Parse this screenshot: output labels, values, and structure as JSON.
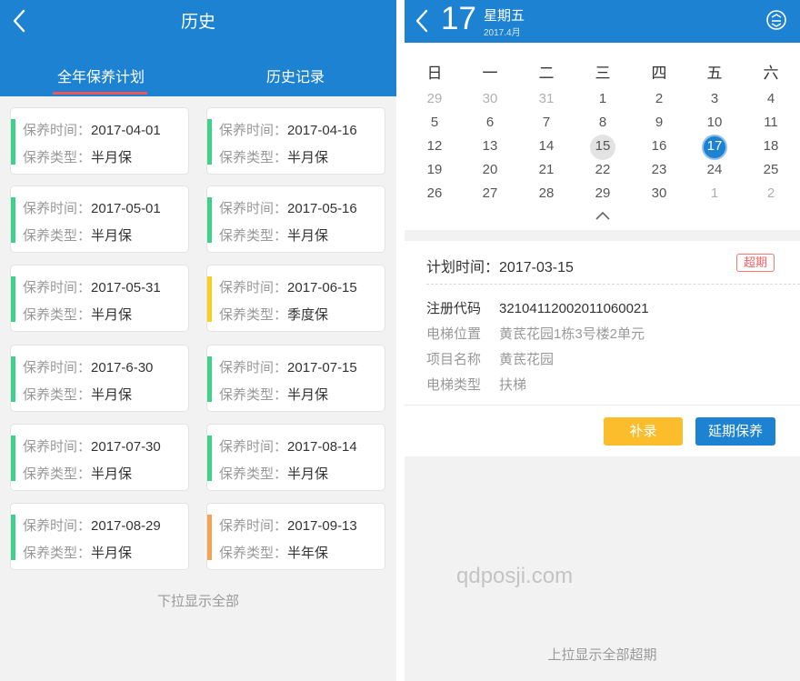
{
  "left": {
    "header": {
      "title": "历史"
    },
    "tabs": [
      {
        "label": "全年保养计划",
        "active": true
      },
      {
        "label": "历史记录",
        "active": false
      }
    ],
    "labels": {
      "time": "保养时间：",
      "type": "保养类型："
    },
    "cards": [
      {
        "time": "2017-04-01",
        "type": "半月保",
        "color": "#3fd08c"
      },
      {
        "time": "2017-04-16",
        "type": "半月保",
        "color": "#3fd08c"
      },
      {
        "time": "2017-05-01",
        "type": "半月保",
        "color": "#3fd08c"
      },
      {
        "time": "2017-05-16",
        "type": "半月保",
        "color": "#3fd08c"
      },
      {
        "time": "2017-05-31",
        "type": "半月保",
        "color": "#3fd08c"
      },
      {
        "time": "2017-06-15",
        "type": "季度保",
        "color": "#f7d21c"
      },
      {
        "time": "2017-6-30",
        "type": "半月保",
        "color": "#3fd08c"
      },
      {
        "time": "2017-07-15",
        "type": "半月保",
        "color": "#3fd08c"
      },
      {
        "time": "2017-07-30",
        "type": "半月保",
        "color": "#3fd08c"
      },
      {
        "time": "2017-08-14",
        "type": "半月保",
        "color": "#3fd08c"
      },
      {
        "time": "2017-08-29",
        "type": "半月保",
        "color": "#3fd08c"
      },
      {
        "time": "2017-09-13",
        "type": "半年保",
        "color": "#f5a156"
      }
    ],
    "footer": "下拉显示全部"
  },
  "right": {
    "header": {
      "day": "17",
      "weekday": "星期五",
      "month": "2017.4月"
    },
    "calendar": {
      "weekdays": [
        "日",
        "一",
        "二",
        "三",
        "四",
        "五",
        "六"
      ],
      "weeks": [
        [
          "29",
          "30",
          "31",
          "1",
          "2",
          "3",
          "4"
        ],
        [
          "5",
          "6",
          "7",
          "8",
          "9",
          "10",
          "11"
        ],
        [
          "12",
          "13",
          "14",
          "15",
          "16",
          "17",
          "18"
        ],
        [
          "19",
          "20",
          "21",
          "22",
          "23",
          "24",
          "25"
        ],
        [
          "26",
          "27",
          "28",
          "29",
          "30",
          "1",
          "2"
        ]
      ],
      "today": "15",
      "selected": "17"
    },
    "plan": {
      "label": "计划时间：",
      "value": "2017-03-15",
      "status": "超期"
    },
    "details": [
      {
        "label": "注册代码",
        "value": "32104112002011060021"
      },
      {
        "label": "电梯位置",
        "value": "黄茋花园1栋3号楼2单元"
      },
      {
        "label": "项目名称",
        "value": "黄茋花园"
      },
      {
        "label": "电梯类型",
        "value": "扶梯"
      }
    ],
    "buttons": {
      "supplement": "补录",
      "postpone": "延期保养"
    },
    "footer": "上拉显示全部超期"
  },
  "watermark": "qdposji.com"
}
